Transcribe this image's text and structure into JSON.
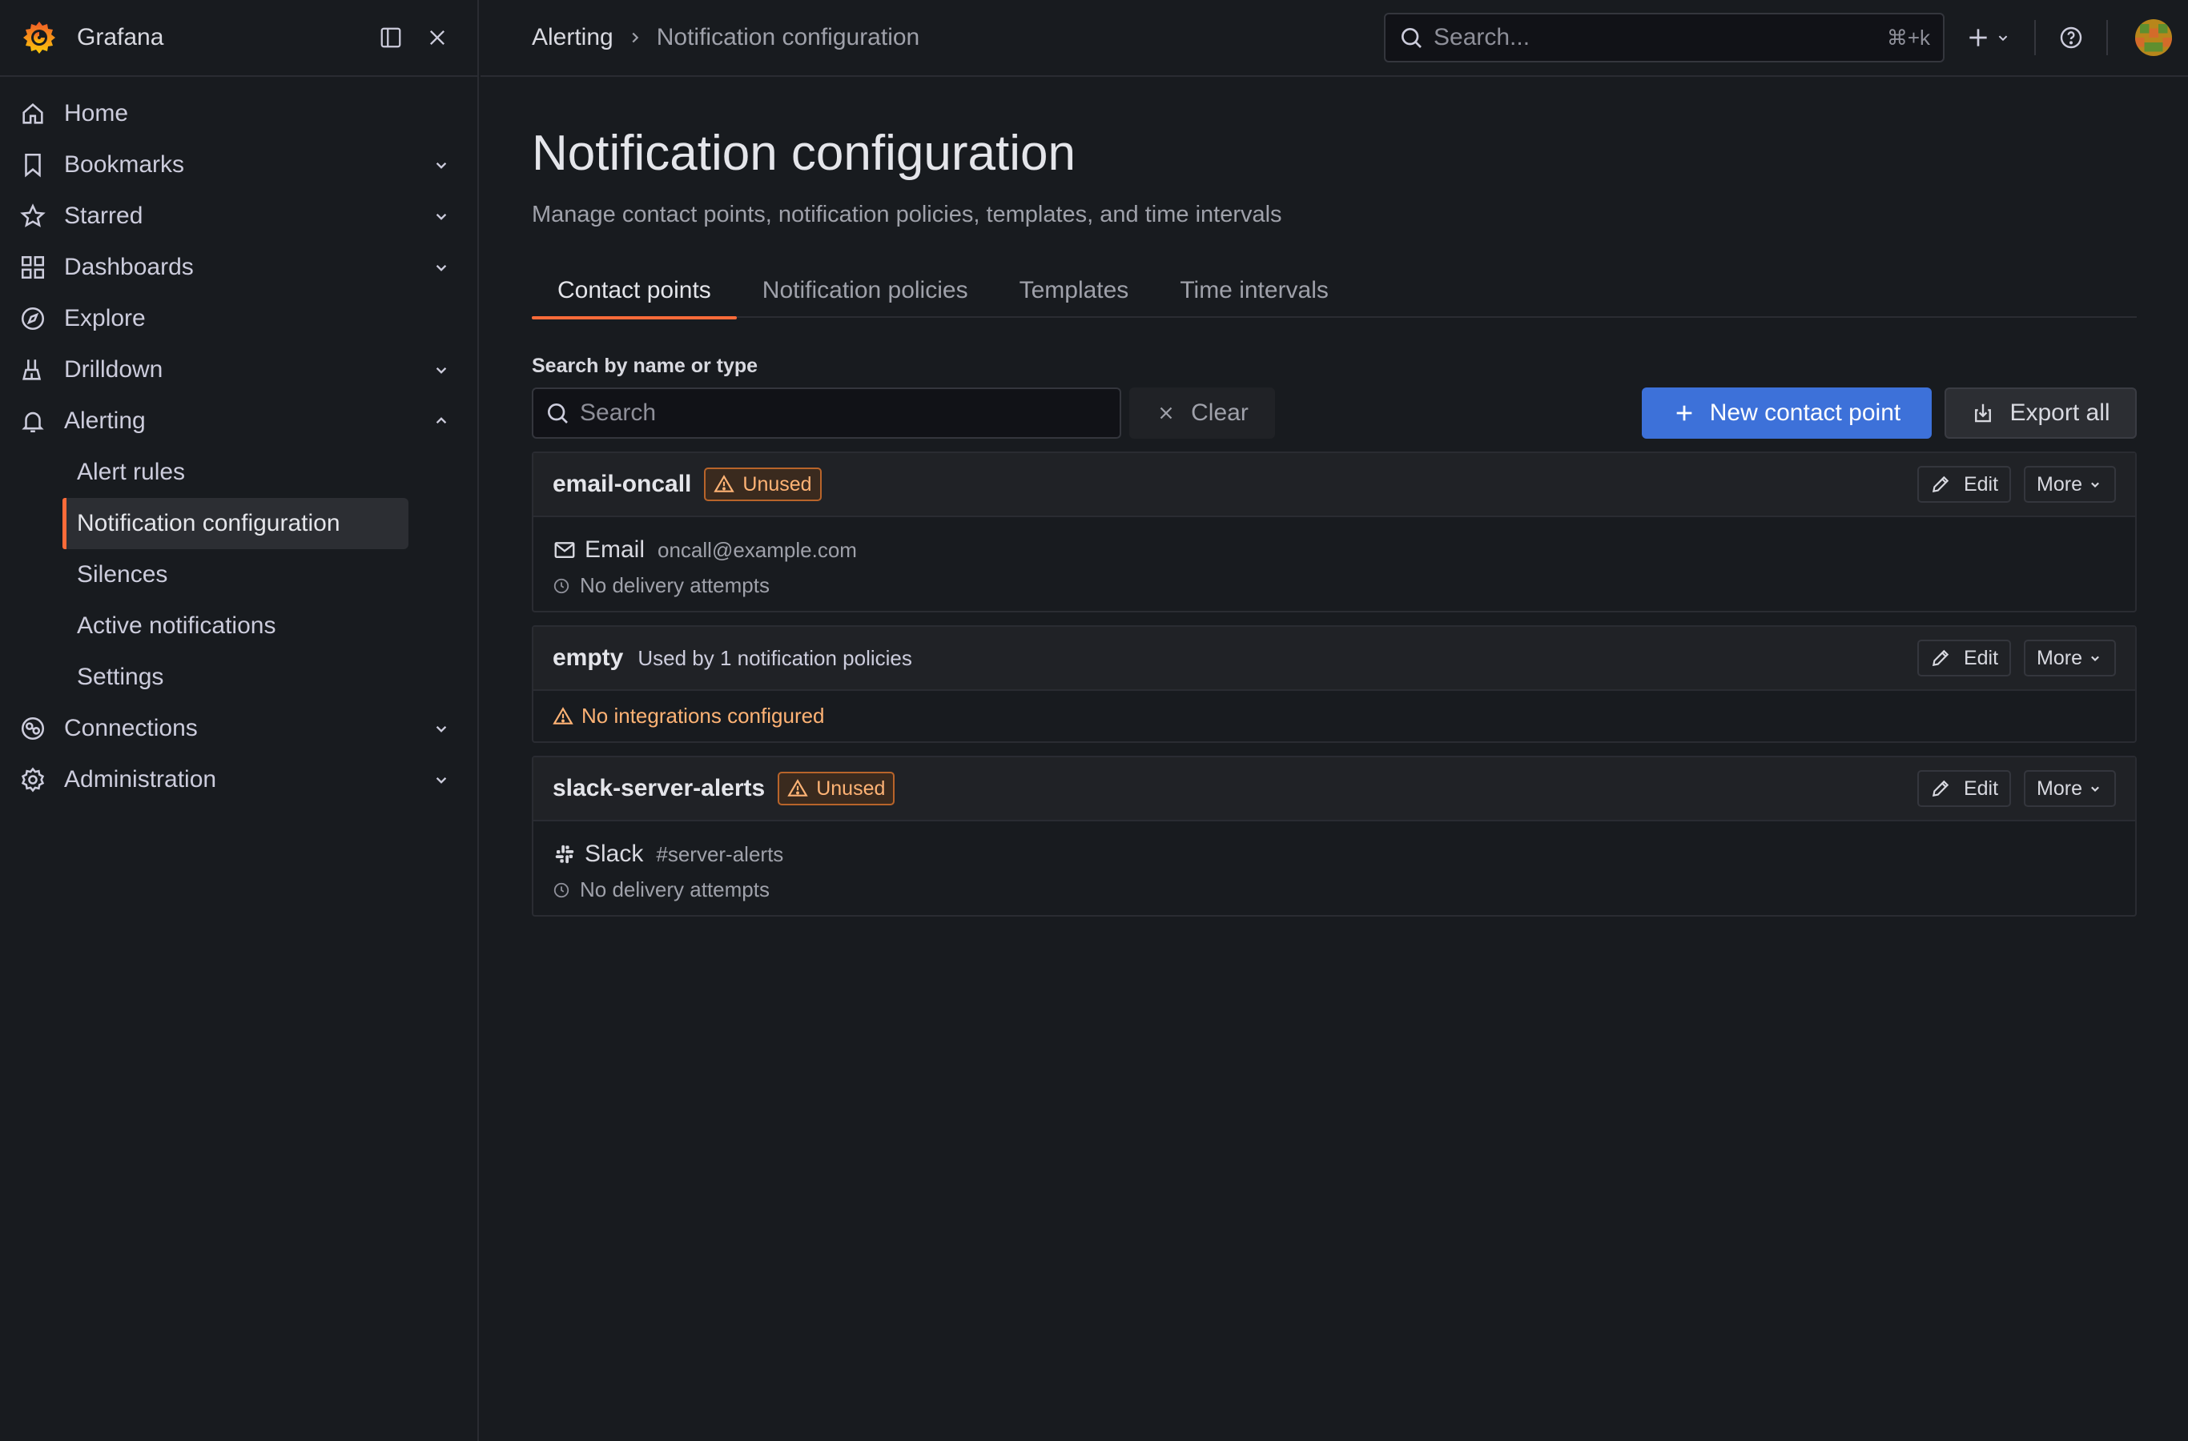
{
  "app": {
    "name": "Grafana"
  },
  "sidebar": {
    "items": [
      {
        "label": "Home",
        "icon": "home-icon"
      },
      {
        "label": "Bookmarks",
        "icon": "bookmark-icon"
      },
      {
        "label": "Starred",
        "icon": "star-icon"
      },
      {
        "label": "Dashboards",
        "icon": "apps-icon"
      },
      {
        "label": "Explore",
        "icon": "compass-icon"
      },
      {
        "label": "Drilldown",
        "icon": "drilldown-icon"
      },
      {
        "label": "Alerting",
        "icon": "bell-icon"
      },
      {
        "label": "Connections",
        "icon": "connections-icon"
      },
      {
        "label": "Administration",
        "icon": "cog-icon"
      }
    ],
    "alerting_children": [
      {
        "label": "Alert rules"
      },
      {
        "label": "Notification configuration"
      },
      {
        "label": "Silences"
      },
      {
        "label": "Active notifications"
      },
      {
        "label": "Settings"
      }
    ]
  },
  "topbar": {
    "breadcrumb": [
      "Alerting",
      "Notification configuration"
    ],
    "search_placeholder": "Search...",
    "search_shortcut": "⌘+k"
  },
  "page": {
    "title": "Notification configuration",
    "subtitle": "Manage contact points, notification policies, templates, and time intervals",
    "tabs": [
      {
        "label": "Contact points",
        "active": true
      },
      {
        "label": "Notification policies",
        "active": false
      },
      {
        "label": "Templates",
        "active": false
      },
      {
        "label": "Time intervals",
        "active": false
      }
    ]
  },
  "filter": {
    "label": "Search by name or type",
    "placeholder": "Search",
    "clear_label": "Clear",
    "new_label": "New contact point",
    "export_label": "Export all"
  },
  "contact_points": [
    {
      "name": "email-oncall",
      "badge": "Unused",
      "integration": {
        "icon": "envelope-icon",
        "name": "Email",
        "detail": "oncall@example.com"
      },
      "delivery": "No delivery attempts",
      "edit_label": "Edit",
      "more_label": "More"
    },
    {
      "name": "empty",
      "usage": "Used by 1 notification policies",
      "warning": "No integrations configured",
      "edit_label": "Edit",
      "more_label": "More"
    },
    {
      "name": "slack-server-alerts",
      "badge": "Unused",
      "integration": {
        "icon": "slack-icon",
        "name": "Slack",
        "detail": "#server-alerts"
      },
      "delivery": "No delivery attempts",
      "edit_label": "Edit",
      "more_label": "More"
    }
  ],
  "colors": {
    "background": "#181b1f",
    "accent_orange": "#ff6b39",
    "primary_blue": "#3d71d9",
    "warning": "#ffb375"
  }
}
